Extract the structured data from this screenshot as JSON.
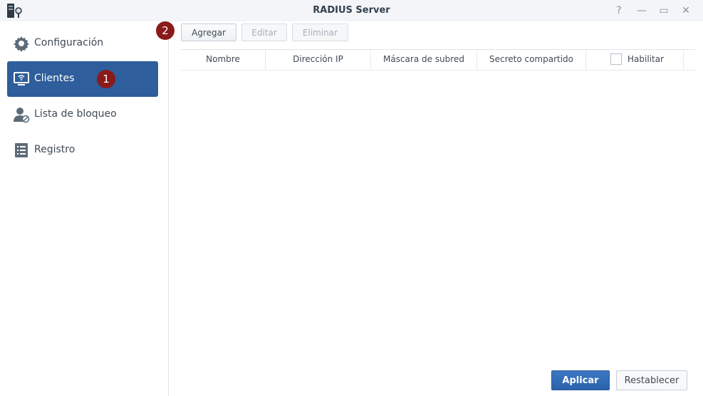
{
  "window": {
    "title": "RADIUS Server",
    "controls": [
      {
        "name": "help-icon",
        "glyph": "?"
      },
      {
        "name": "minimize-icon",
        "glyph": "—"
      },
      {
        "name": "maximize-icon",
        "glyph": "▭"
      },
      {
        "name": "close-icon",
        "glyph": "✕"
      }
    ]
  },
  "sidebar": {
    "items": [
      {
        "label": "Configuración",
        "icon": "gear-icon",
        "active": false
      },
      {
        "label": "Clientes",
        "icon": "monitor-wifi-icon",
        "active": true
      },
      {
        "label": "Lista de bloqueo",
        "icon": "user-block-icon",
        "active": false
      },
      {
        "label": "Registro",
        "icon": "log-list-icon",
        "active": false
      }
    ]
  },
  "annotations": {
    "badge1": "1",
    "badge2": "2"
  },
  "toolbar": {
    "add_label": "Agregar",
    "edit_label": "Editar",
    "delete_label": "Eliminar"
  },
  "table": {
    "columns": [
      "Nombre",
      "Dirección IP",
      "Máscara de subred",
      "Secreto compartido",
      "Habilitar"
    ],
    "rows": []
  },
  "footer": {
    "apply_label": "Aplicar",
    "reset_label": "Restablecer"
  },
  "colors": {
    "accent": "#2e5e9b",
    "badge": "#8b1a1a",
    "apply": "#2a62ab"
  }
}
